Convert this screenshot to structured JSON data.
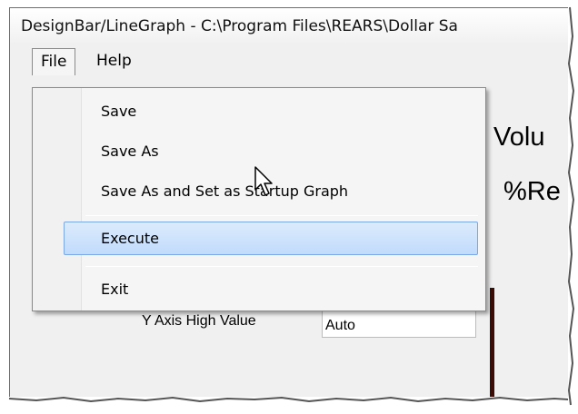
{
  "window": {
    "title": "DesignBar/LineGraph - C:\\Program Files\\REARS\\Dollar Sa"
  },
  "menubar": {
    "items": [
      {
        "label": "File",
        "open": true
      },
      {
        "label": "Help",
        "open": false
      }
    ]
  },
  "file_menu": {
    "items": [
      {
        "label": "Save"
      },
      {
        "label": "Save As"
      },
      {
        "label": "Save As and Set as Startup Graph"
      },
      {
        "label": "Execute",
        "highlighted": true
      },
      {
        "label": "Exit"
      }
    ]
  },
  "graph_preview": {
    "title_line1": "Volu",
    "title_line2": "%Re"
  },
  "form": {
    "y_axis_high_label": "Y Axis High Value",
    "y_axis_high_value": "Auto"
  },
  "colors": {
    "menu_highlight_fill": "#c9e0fb",
    "menu_highlight_border": "#7aa7e8",
    "bar_color": "#3c0d07",
    "form_background": "#f0f0f0"
  },
  "icons": {
    "cursor": "mouse-pointer-icon"
  }
}
